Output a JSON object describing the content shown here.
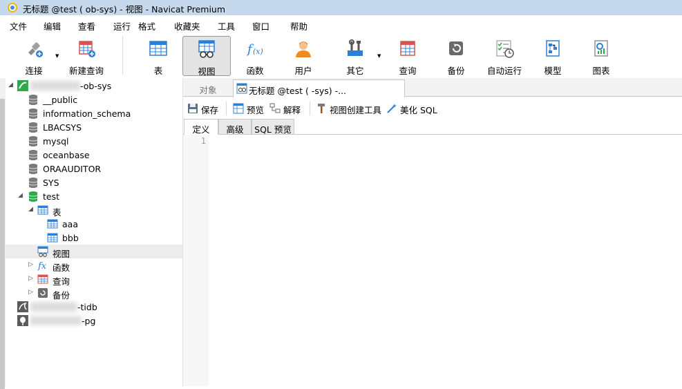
{
  "titlebar": {
    "title": "无标题 @test (            ob-sys) - 视图 - Navicat Premium"
  },
  "menu": [
    "文件",
    "编辑",
    "查看",
    "运行",
    "格式",
    "收藏夹",
    "工具",
    "窗口",
    "帮助"
  ],
  "toolbar": {
    "connect": "连接",
    "new_query": "新建查询",
    "table": "表",
    "view": "视图",
    "function": "函数",
    "user": "用户",
    "other": "其它",
    "query": "查询",
    "backup": "备份",
    "automation": "自动运行",
    "model": "模型",
    "chart": "图表"
  },
  "tree": {
    "conn1_suffix": "-ob-sys",
    "schemas": [
      "__public",
      "information_schema",
      "LBACSYS",
      "mysql",
      "oceanbase",
      "ORAAUDITOR",
      "SYS"
    ],
    "test": "test",
    "tables_label": "表",
    "tables": [
      "aaa",
      "bbb"
    ],
    "views_label": "视图",
    "functions_label": "函数",
    "queries_label": "查询",
    "backups_label": "备份",
    "conn2_suffix": "-tidb",
    "conn3_suffix": "-pg"
  },
  "tabs": {
    "objects": "对象",
    "current": "无标题 @test (                    -sys) -..."
  },
  "editor_toolbar": {
    "save": "保存",
    "preview": "预览",
    "explain": "解释",
    "view_builder": "视图创建工具",
    "beautify": "美化 SQL"
  },
  "subtabs": {
    "definition": "定义",
    "advanced": "高级",
    "sql_preview": "SQL 预览"
  },
  "editor": {
    "line1": "1"
  }
}
